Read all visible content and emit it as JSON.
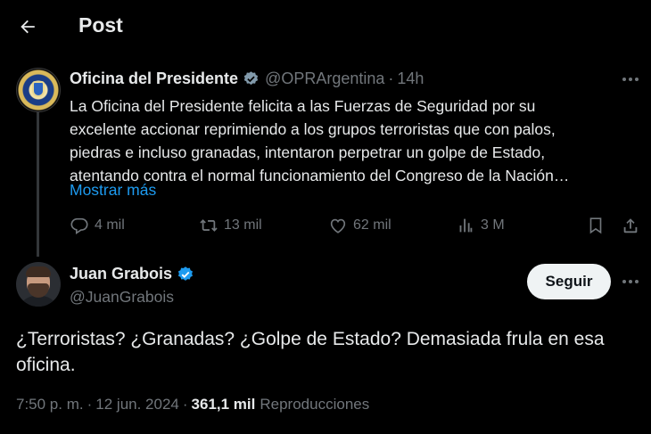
{
  "header": {
    "title": "Post"
  },
  "post1": {
    "author_name": "Oficina del Presidente",
    "handle": "@OPRArgentina",
    "separator": "·",
    "time": "14h",
    "text_lines": [
      "La Oficina del Presidente felicita a las Fuerzas de Seguridad por su",
      "excelente accionar reprimiendo a los grupos terroristas que con palos,",
      "piedras e incluso granadas, intentaron perpetrar un golpe de Estado,",
      "atentando contra el normal funcionamiento del Congreso de la Nación…"
    ],
    "show_more": "Mostrar más",
    "verified_badge": "gray-verified-icon",
    "actions": {
      "replies": "4 mil",
      "reposts": "13 mil",
      "likes": "62 mil",
      "views": "3 M"
    }
  },
  "post2": {
    "author_name": "Juan Grabois",
    "handle": "@JuanGrabois",
    "verified_badge": "blue-verified-icon",
    "follow_label": "Seguir",
    "text_lines": [
      "¿Terroristas? ¿Granadas? ¿Golpe de Estado? Demasiada frula en esa",
      "oficina."
    ],
    "meta": {
      "time": "7:50 p. m.",
      "sep1": "·",
      "date": "12 jun. 2024",
      "sep2": "·",
      "views_count": "361,1 mil",
      "views_label": "Reproducciones"
    }
  },
  "colors": {
    "background": "#000000",
    "text": "#e7e9ea",
    "muted": "#71767b",
    "link": "#1d9bf0",
    "follow_button_bg": "#eff3f4"
  }
}
